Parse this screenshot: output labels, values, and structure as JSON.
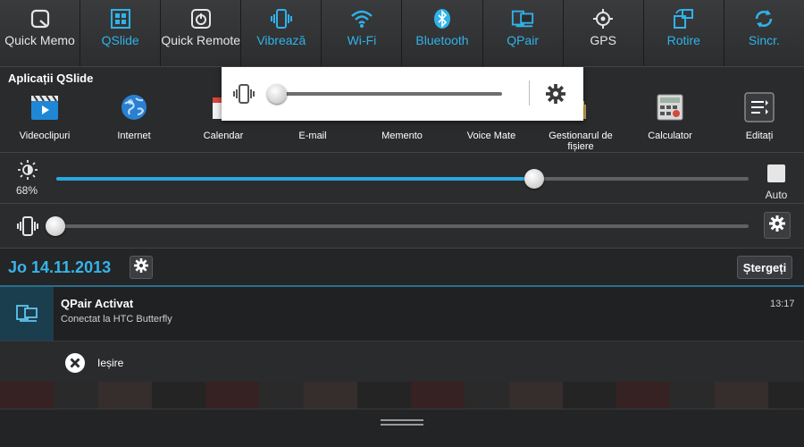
{
  "toggles": [
    {
      "label": "Quick Memo",
      "icon": "quick-memo-icon",
      "active": false
    },
    {
      "label": "QSlide",
      "icon": "qslide-icon",
      "active": true
    },
    {
      "label": "Quick Remote",
      "icon": "power-icon",
      "active": false
    },
    {
      "label": "Vibrează",
      "icon": "vibrate-icon",
      "active": true
    },
    {
      "label": "Wi-Fi",
      "icon": "wifi-icon",
      "active": true
    },
    {
      "label": "Bluetooth",
      "icon": "bluetooth-icon",
      "active": true
    },
    {
      "label": "QPair",
      "icon": "qpair-icon",
      "active": true
    },
    {
      "label": "GPS",
      "icon": "gps-icon",
      "active": false
    },
    {
      "label": "Rotire",
      "icon": "rotate-icon",
      "active": true
    },
    {
      "label": "Sincr.",
      "icon": "sync-icon",
      "active": true
    }
  ],
  "qslide": {
    "title": "Aplicații QSlide",
    "apps": [
      {
        "label": "Videoclipuri",
        "icon": "video-icon"
      },
      {
        "label": "Internet",
        "icon": "globe-icon"
      },
      {
        "label": "Calendar",
        "icon": "calendar-icon"
      },
      {
        "label": "E-mail",
        "icon": "email-icon"
      },
      {
        "label": "Memento",
        "icon": "memo-icon"
      },
      {
        "label": "Voice Mate",
        "icon": "voice-mate-icon"
      },
      {
        "label": "Gestionarul de fișiere",
        "icon": "file-manager-icon"
      },
      {
        "label": "Calculator",
        "icon": "calculator-icon"
      },
      {
        "label": "Editați",
        "icon": "edit-list-icon"
      }
    ]
  },
  "brightness": {
    "percent_label": "68%",
    "level": 0.69,
    "auto_label": "Auto"
  },
  "volume": {
    "level": 0.0
  },
  "popup_volume": {
    "level": 0.0
  },
  "date_bar": {
    "date": "Jo 14.11.2013",
    "clear_label": "Ștergeți"
  },
  "notification": {
    "title": "QPair Activat",
    "subtitle": "Conectat la HTC Butterfly",
    "time": "13:17",
    "action_label": "Ieșire"
  },
  "colors": {
    "accent": "#2fb3ea",
    "panel": "#2b2c2e",
    "highlight_line": "#2a6e8d"
  }
}
